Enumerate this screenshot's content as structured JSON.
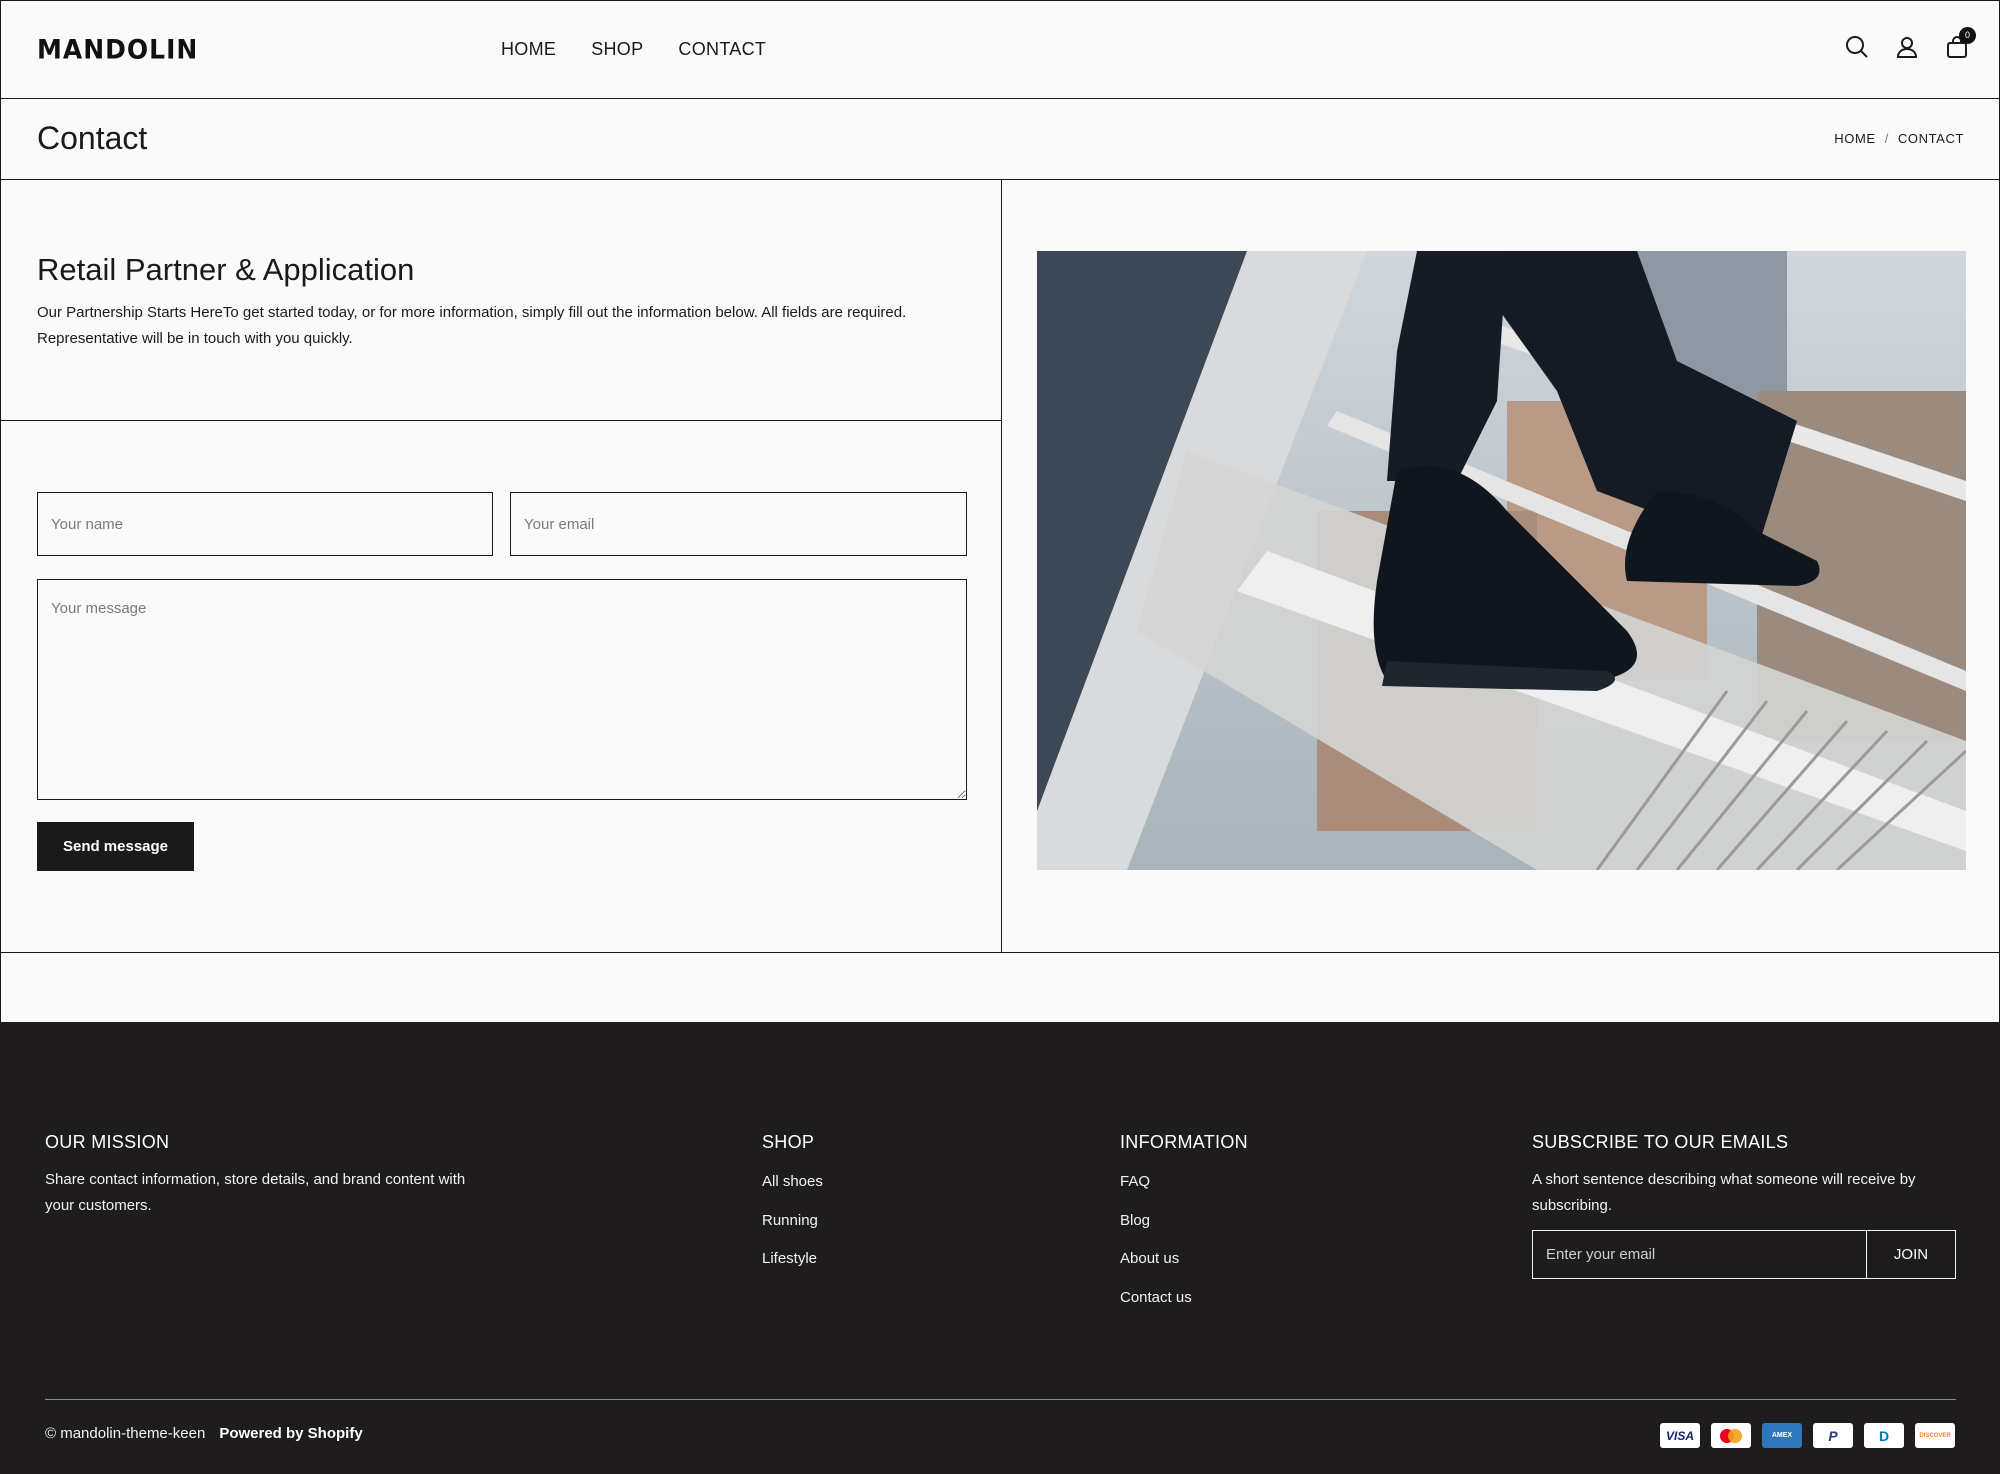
{
  "header": {
    "logo": "MANDOLIN",
    "nav": [
      {
        "label": "HOME"
      },
      {
        "label": "SHOP"
      },
      {
        "label": "CONTACT"
      }
    ],
    "icons": [
      "search-icon",
      "account-icon",
      "cart-icon"
    ],
    "cart_count": "0"
  },
  "titlebar": {
    "title": "Contact",
    "breadcrumb": {
      "home": "HOME",
      "separator": "/",
      "current": "CONTACT"
    }
  },
  "intro": {
    "heading": "Retail Partner & Application",
    "body": "Our Partnership Starts HereTo get started today, or for more information, simply fill out the information below. All fields are required. Representative will be in touch with you quickly."
  },
  "form": {
    "name_placeholder": "Your name",
    "email_placeholder": "Your email",
    "message_placeholder": "Your message",
    "name_value": "",
    "email_value": "",
    "message_value": "",
    "submit_label": "Send message"
  },
  "footer": {
    "mission": {
      "heading": "OUR MISSION",
      "text": "Share contact information, store details, and brand content with your customers."
    },
    "shop": {
      "heading": "SHOP",
      "links": [
        "All shoes",
        "Running",
        "Lifestyle"
      ]
    },
    "information": {
      "heading": "INFORMATION",
      "links": [
        "FAQ",
        "Blog",
        "About us",
        "Contact us"
      ]
    },
    "subscribe": {
      "heading": "SUBSCRIBE TO OUR EMAILS",
      "text": "A short sentence describing what someone will receive by subscribing.",
      "placeholder": "Enter your email",
      "button": "JOIN"
    },
    "copyright": "© mandolin-theme-keen",
    "powered": "Powered by Shopify",
    "payments": [
      {
        "label": "VISA",
        "color": "#1a1f71"
      },
      {
        "label": "",
        "color": "#eb001b"
      },
      {
        "label": "AMEX",
        "color": "#2e77bc"
      },
      {
        "label": "P",
        "color": "#253b80"
      },
      {
        "label": "D",
        "color": "#0079be"
      },
      {
        "label": "DISCOVER",
        "color": "#f58220"
      }
    ]
  },
  "colors": {
    "ink": "#1b1a1b",
    "page_bg": "#fafafa",
    "footer_bg": "#1e1c1d"
  }
}
